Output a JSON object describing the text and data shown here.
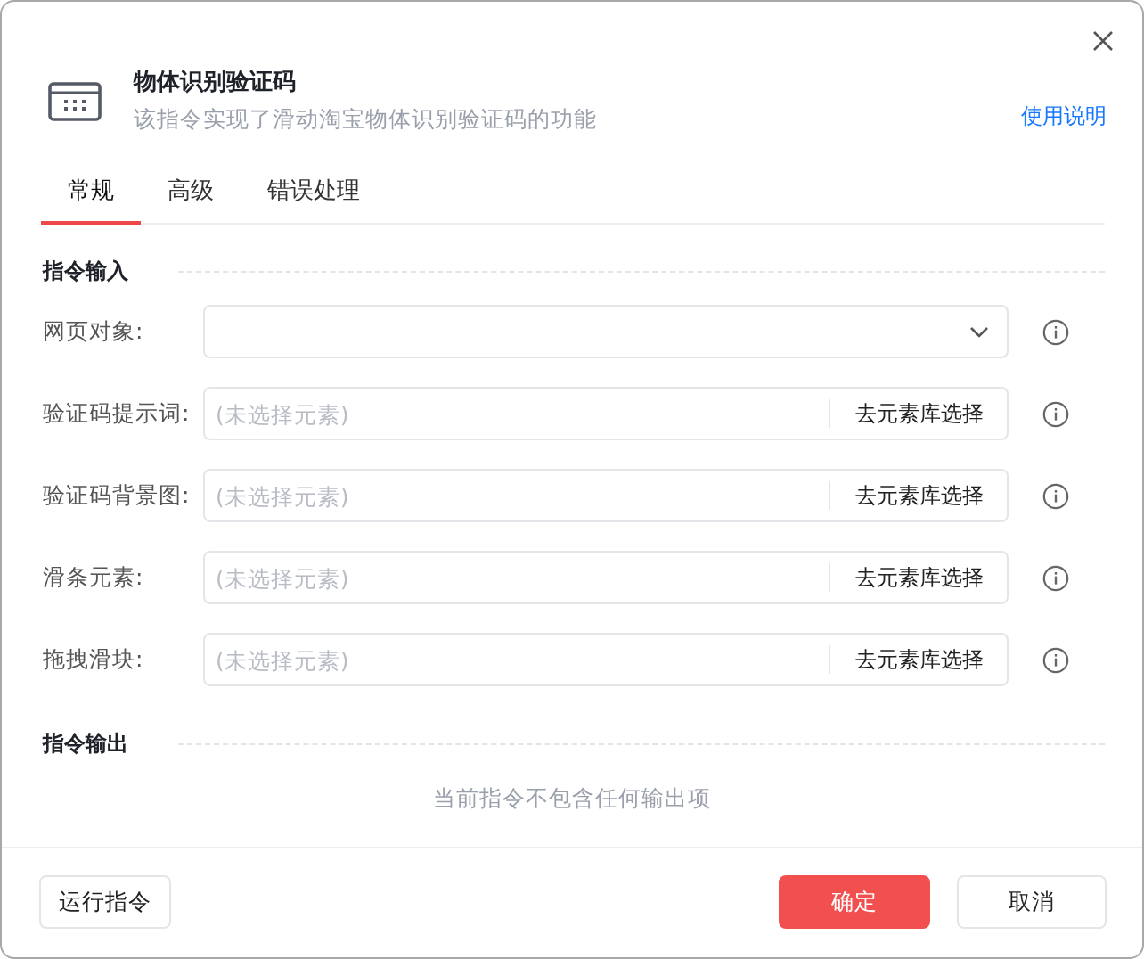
{
  "header": {
    "title": "物体识别验证码",
    "description": "该指令实现了滑动淘宝物体识别验证码的功能",
    "help_link": "使用说明"
  },
  "tabs": [
    {
      "label": "常规",
      "selected": true
    },
    {
      "label": "高级",
      "selected": false
    },
    {
      "label": "错误处理",
      "selected": false
    }
  ],
  "input_section": {
    "title": "指令输入",
    "fields": [
      {
        "kind": "select",
        "label": "网页对象:"
      },
      {
        "kind": "element",
        "label": "验证码提示词:",
        "placeholder": "(未选择元素)",
        "button": "去元素库选择"
      },
      {
        "kind": "element",
        "label": "验证码背景图:",
        "placeholder": "(未选择元素)",
        "button": "去元素库选择"
      },
      {
        "kind": "element",
        "label": "滑条元素:",
        "placeholder": "(未选择元素)",
        "button": "去元素库选择"
      },
      {
        "kind": "element",
        "label": "拖拽滑块:",
        "placeholder": "(未选择元素)",
        "button": "去元素库选择"
      }
    ]
  },
  "output_section": {
    "title": "指令输出",
    "empty_text": "当前指令不包含任何输出项"
  },
  "footer": {
    "run_button": "运行指令",
    "confirm_button": "确定",
    "cancel_button": "取消"
  }
}
